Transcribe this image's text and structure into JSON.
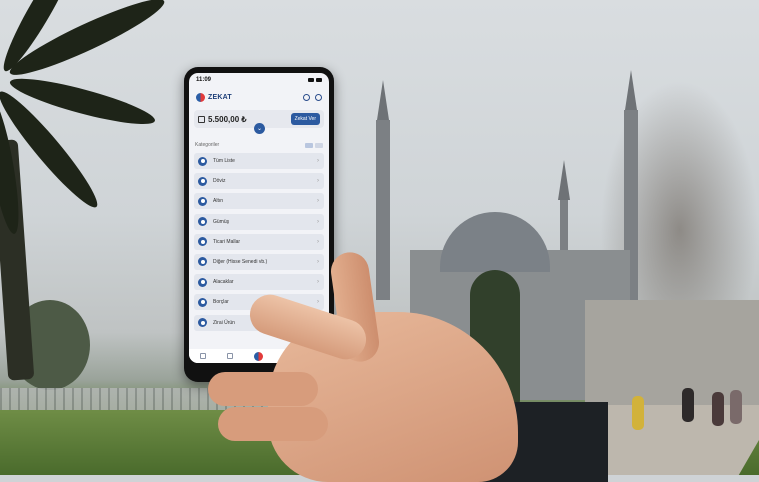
{
  "phone": {
    "status_time": "11:09",
    "brand": "ZEKAT",
    "amount": "5.500,00 ₺",
    "pay_button": "Zekat Ver",
    "section_title": "Kategoriler",
    "items": [
      {
        "label": "Tüm Liste"
      },
      {
        "label": "Döviz"
      },
      {
        "label": "Altın"
      },
      {
        "label": "Gümüş"
      },
      {
        "label": "Ticari Mallar"
      },
      {
        "label": "Diğer (Hisse Senedi vb.)"
      },
      {
        "label": "Alacaklar"
      },
      {
        "label": "Borçlar"
      },
      {
        "label": "Zirai Ürün"
      }
    ]
  },
  "colors": {
    "accent": "#2c5aa0",
    "sky": "#d9dde0",
    "grass": "#4a6b2c"
  }
}
